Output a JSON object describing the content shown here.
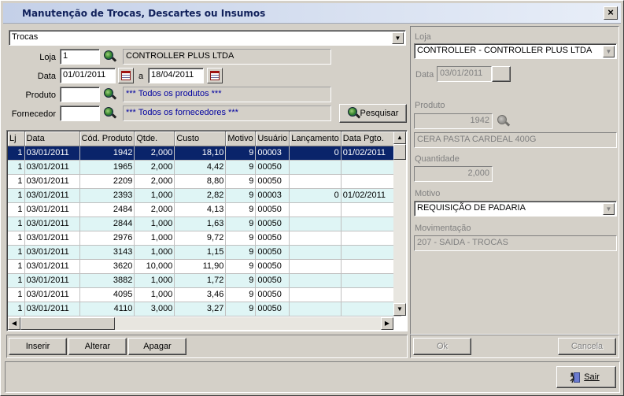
{
  "window": {
    "title": "Manutenção de Trocas, Descartes ou Insumos",
    "close_glyph": "×"
  },
  "filters": {
    "type_combo": "Trocas",
    "loja_label": "Loja",
    "loja_code": "1",
    "loja_name": "CONTROLLER PLUS LTDA",
    "data_label": "Data",
    "date_from": "01/01/2011",
    "date_sep": "a",
    "date_to": "18/04/2011",
    "produto_label": "Produto",
    "produto_code": "",
    "produto_desc": "*** Todos os produtos ***",
    "fornecedor_label": "Fornecedor",
    "fornecedor_code": "",
    "fornecedor_desc": "*** Todos os fornecedores ***",
    "search_button": "Pesquisar"
  },
  "grid": {
    "columns": [
      "Lj",
      "Data",
      "Cód. Produto",
      "Qtde.",
      "Custo",
      "Motivo",
      "Usuário",
      "Lançamento",
      "Data Pgto."
    ],
    "rows": [
      [
        "1",
        "03/01/2011",
        "1942",
        "2,000",
        "18,10",
        "9",
        "00003",
        "0",
        "01/02/2011"
      ],
      [
        "1",
        "03/01/2011",
        "1965",
        "2,000",
        "4,42",
        "9",
        "00050",
        "",
        ""
      ],
      [
        "1",
        "03/01/2011",
        "2209",
        "2,000",
        "8,80",
        "9",
        "00050",
        "",
        ""
      ],
      [
        "1",
        "03/01/2011",
        "2393",
        "1,000",
        "2,82",
        "9",
        "00003",
        "0",
        "01/02/2011"
      ],
      [
        "1",
        "03/01/2011",
        "2484",
        "2,000",
        "4,13",
        "9",
        "00050",
        "",
        ""
      ],
      [
        "1",
        "03/01/2011",
        "2844",
        "1,000",
        "1,63",
        "9",
        "00050",
        "",
        ""
      ],
      [
        "1",
        "03/01/2011",
        "2976",
        "1,000",
        "9,72",
        "9",
        "00050",
        "",
        ""
      ],
      [
        "1",
        "03/01/2011",
        "3143",
        "1,000",
        "1,15",
        "9",
        "00050",
        "",
        ""
      ],
      [
        "1",
        "03/01/2011",
        "3620",
        "10,000",
        "11,90",
        "9",
        "00050",
        "",
        ""
      ],
      [
        "1",
        "03/01/2011",
        "3882",
        "1,000",
        "1,72",
        "9",
        "00050",
        "",
        ""
      ],
      [
        "1",
        "03/01/2011",
        "4095",
        "1,000",
        "3,46",
        "9",
        "00050",
        "",
        ""
      ],
      [
        "1",
        "03/01/2011",
        "4110",
        "3,000",
        "3,27",
        "9",
        "00050",
        "",
        ""
      ]
    ]
  },
  "actions": {
    "insert": "Inserir",
    "edit": "Alterar",
    "delete": "Apagar"
  },
  "detail": {
    "loja_label": "Loja",
    "loja_value": "CONTROLLER - CONTROLLER PLUS LTDA",
    "data_label": "Data",
    "data_value": "03/01/2011",
    "produto_label": "Produto",
    "produto_code": "1942",
    "produto_desc": "CERA PASTA CARDEAL 400G",
    "quantidade_label": "Quantidade",
    "quantidade_value": "2,000",
    "motivo_label": "Motivo",
    "motivo_value": "REQUISIÇÃO DE PADARIA",
    "movimentacao_label": "Movimentação",
    "movimentacao_value": "207 - SAIDA - TROCAS",
    "ok_button": "Ok",
    "cancel_button": "Cancela"
  },
  "footer": {
    "exit_button": "Sair"
  }
}
